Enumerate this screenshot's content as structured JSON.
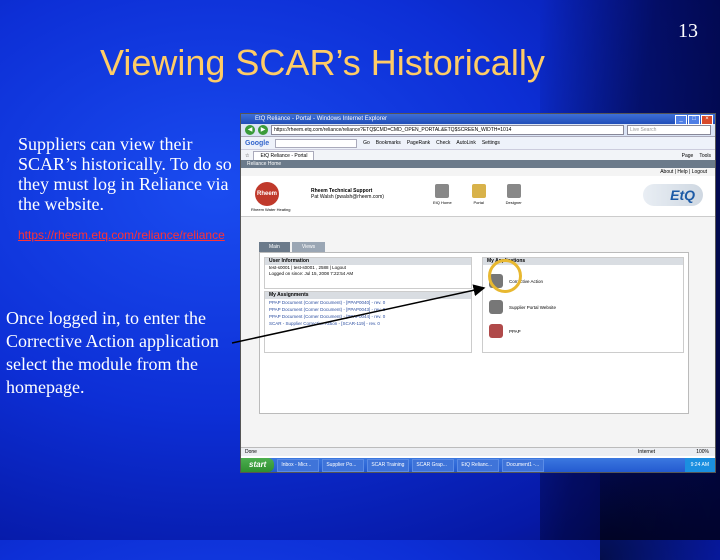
{
  "slide": {
    "number": "13",
    "title": "Viewing SCAR’s Historically",
    "para1": "Suppliers can view their SCAR’s historically. To do so they must log in Reliance via the website.",
    "link": "https://rheem.etq.com/reliance/reliance",
    "para2": "Once logged in, to enter the Corrective Action application select the module from the homepage."
  },
  "browser": {
    "window_title": "EtQ Reliance - Portal - Windows Internet Explorer",
    "address": "https://rheem.etq.com/reliance/reliance?ETQ$CMD=CMD_OPEN_PORTAL&ETQ$SCREEN_WIDTH=1014",
    "search_placeholder": "Live Search",
    "google_label": "Google",
    "toolbar_items": [
      "Go",
      "Bookmarks",
      "PageRank",
      "Check",
      "AutoLink",
      "Settings"
    ],
    "tab_label": "EtQ Reliance - Portal",
    "tab_right_items": [
      "Page",
      "Tools"
    ],
    "site_tab": "Reliance Home",
    "site_links": "About | Help | Logout",
    "company_name": "Rheem Water Heating",
    "logo_text": "Rheem",
    "user_name": "Rheem Technical Support",
    "user_email": "Pat Walsh (pwalsh@rheem.com)",
    "banner_icons": [
      "EtQ Home",
      "Portal",
      "Designer"
    ],
    "brand": "EtQ",
    "page_tabs": [
      "Main",
      "Views"
    ],
    "user_info": {
      "header": "User Information",
      "lines": [
        "test-s0001 | test-s0001 , 2588 | Logout",
        "Logged on since: Jul 15, 2008 7:22:54 AM"
      ]
    },
    "assignments": {
      "header": "My Assignments",
      "items": [
        "PPAP Document (Corner Document) - [PPAP0040] - rev. 0",
        "PPAP Document (Corner Document) - [PPAP0043] - rev. 0",
        "PPAP Document (Corner Document) - [PPAP0044] - rev. 0",
        "SCAR - Supplier Corrective Action - [SCAR-119] - rev. 0"
      ]
    },
    "applications": {
      "header": "My Applications",
      "items": [
        "Corrective Action",
        "Supplier Portal Website",
        "PPAP"
      ]
    },
    "status_text": "Done",
    "status_zone": "Internet",
    "zoom": "100%",
    "start_label": "start",
    "taskbar_items": [
      "Inbox - Micr...",
      "Supplier Po...",
      "SCAR Training",
      "SCAR Grap...",
      "EtQ Relianc...",
      "Document1 -..."
    ],
    "clock": "9:24 AM"
  }
}
